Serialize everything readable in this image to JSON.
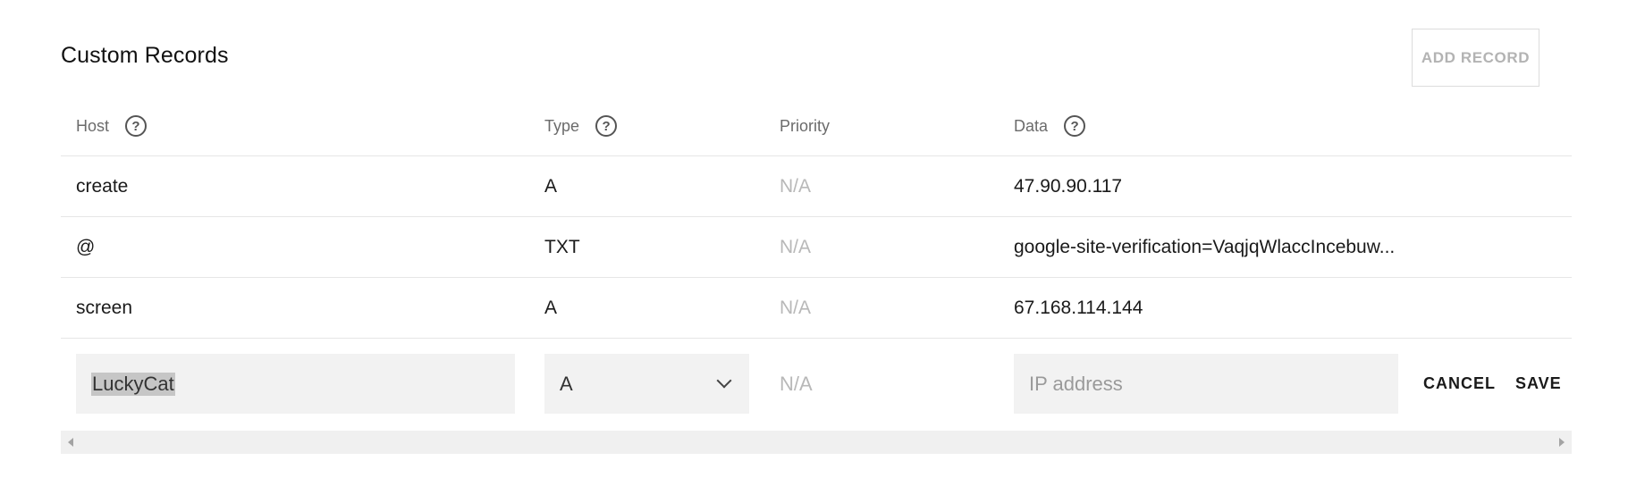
{
  "section": {
    "title": "Custom Records",
    "add_button_label": "ADD RECORD"
  },
  "columns": {
    "host": "Host",
    "type": "Type",
    "priority": "Priority",
    "data": "Data",
    "help_glyph": "?"
  },
  "records": [
    {
      "host": "create",
      "type": "A",
      "priority": "N/A",
      "data": "47.90.90.117"
    },
    {
      "host": "@",
      "type": "TXT",
      "priority": "N/A",
      "data": "google-site-verification=VaqjqWlaccIncebuw..."
    },
    {
      "host": "screen",
      "type": "A",
      "priority": "N/A",
      "data": "67.168.114.144"
    }
  ],
  "edit_row": {
    "host_value": "LuckyCat",
    "type_value": "A",
    "priority": "N/A",
    "data_placeholder": "IP address",
    "cancel_label": "CANCEL",
    "save_label": "SAVE"
  },
  "icons": {
    "help": "help-circle-icon",
    "dropdown": "chevron-down-icon",
    "scroll_left": "arrow-left-icon",
    "scroll_right": "arrow-right-icon"
  }
}
